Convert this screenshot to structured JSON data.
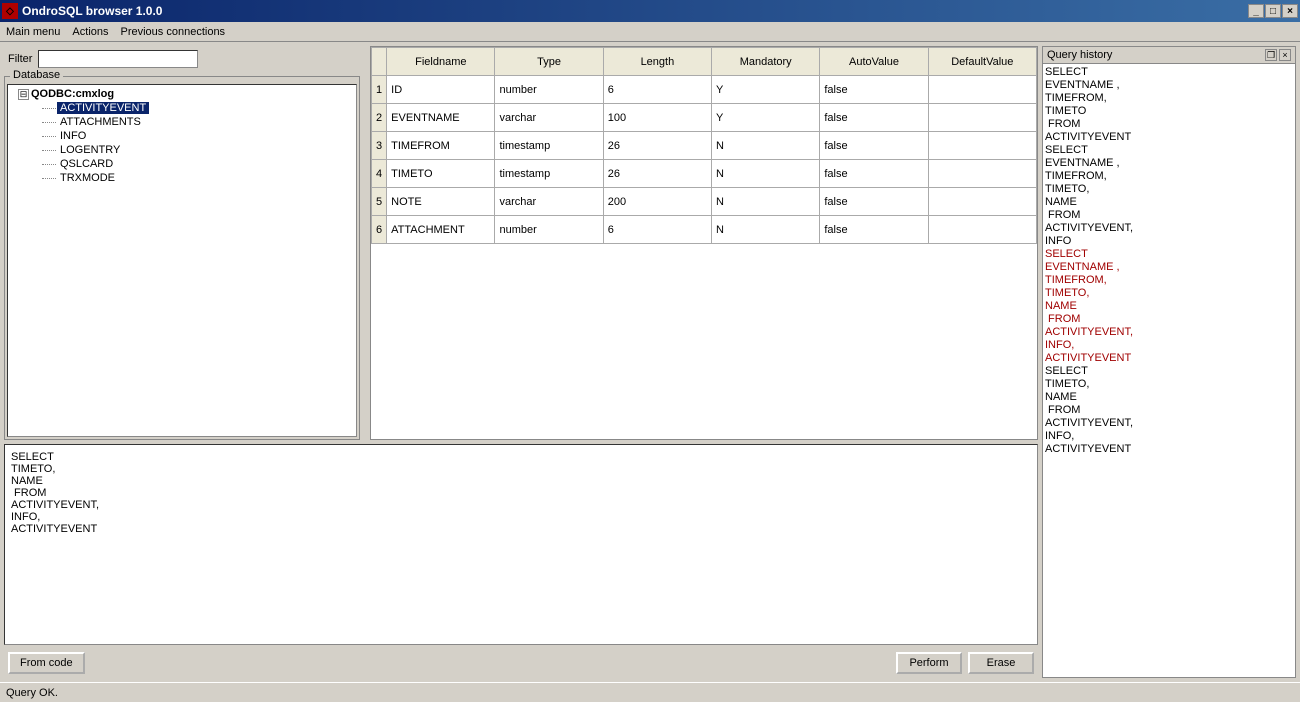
{
  "window": {
    "title": "OndroSQL browser 1.0.0"
  },
  "menu": {
    "items": [
      "Main menu",
      "Actions",
      "Previous connections"
    ]
  },
  "filter": {
    "label": "Filter",
    "value": ""
  },
  "database": {
    "box_label": "Database",
    "root": "QODBC:cmxlog",
    "tables": [
      "ACTIVITYEVENT",
      "ATTACHMENTS",
      "INFO",
      "LOGENTRY",
      "QSLCARD",
      "TRXMODE"
    ],
    "selected": "ACTIVITYEVENT"
  },
  "columns": {
    "headers": [
      "Fieldname",
      "Type",
      "Length",
      "Mandatory",
      "AutoValue",
      "DefaultValue"
    ],
    "rows": [
      {
        "n": "1",
        "field": "ID",
        "type": "number",
        "len": "6",
        "mand": "Y",
        "auto": "false",
        "def": ""
      },
      {
        "n": "2",
        "field": "EVENTNAME",
        "type": "varchar",
        "len": "100",
        "mand": "Y",
        "auto": "false",
        "def": ""
      },
      {
        "n": "3",
        "field": "TIMEFROM",
        "type": "timestamp",
        "len": "26",
        "mand": "N",
        "auto": "false",
        "def": ""
      },
      {
        "n": "4",
        "field": "TIMETO",
        "type": "timestamp",
        "len": "26",
        "mand": "N",
        "auto": "false",
        "def": ""
      },
      {
        "n": "5",
        "field": "NOTE",
        "type": "varchar",
        "len": "200",
        "mand": "N",
        "auto": "false",
        "def": ""
      },
      {
        "n": "6",
        "field": "ATTACHMENT",
        "type": "number",
        "len": "6",
        "mand": "N",
        "auto": "false",
        "def": ""
      }
    ]
  },
  "sql": {
    "text": "SELECT\nTIMETO,\nNAME\n FROM\nACTIVITYEVENT,\nINFO,\nACTIVITYEVENT"
  },
  "buttons": {
    "from_code": "From code",
    "perform": "Perform",
    "erase": "Erase"
  },
  "history": {
    "title": "Query history",
    "entries": [
      {
        "text": "SELECT\nEVENTNAME ,\nTIMEFROM,\nTIMETO\n FROM\nACTIVITYEVENT",
        "error": false
      },
      {
        "text": "SELECT\nEVENTNAME ,\nTIMEFROM,\nTIMETO,\nNAME\n FROM\nACTIVITYEVENT,\nINFO",
        "error": false
      },
      {
        "text": "SELECT\nEVENTNAME ,\nTIMEFROM,\nTIMETO,\nNAME\n FROM\nACTIVITYEVENT,\nINFO,\nACTIVITYEVENT",
        "error": true
      },
      {
        "text": "SELECT\nTIMETO,\nNAME\n FROM\nACTIVITYEVENT,\nINFO,\nACTIVITYEVENT",
        "error": false
      }
    ]
  },
  "status": {
    "text": "Query OK."
  }
}
